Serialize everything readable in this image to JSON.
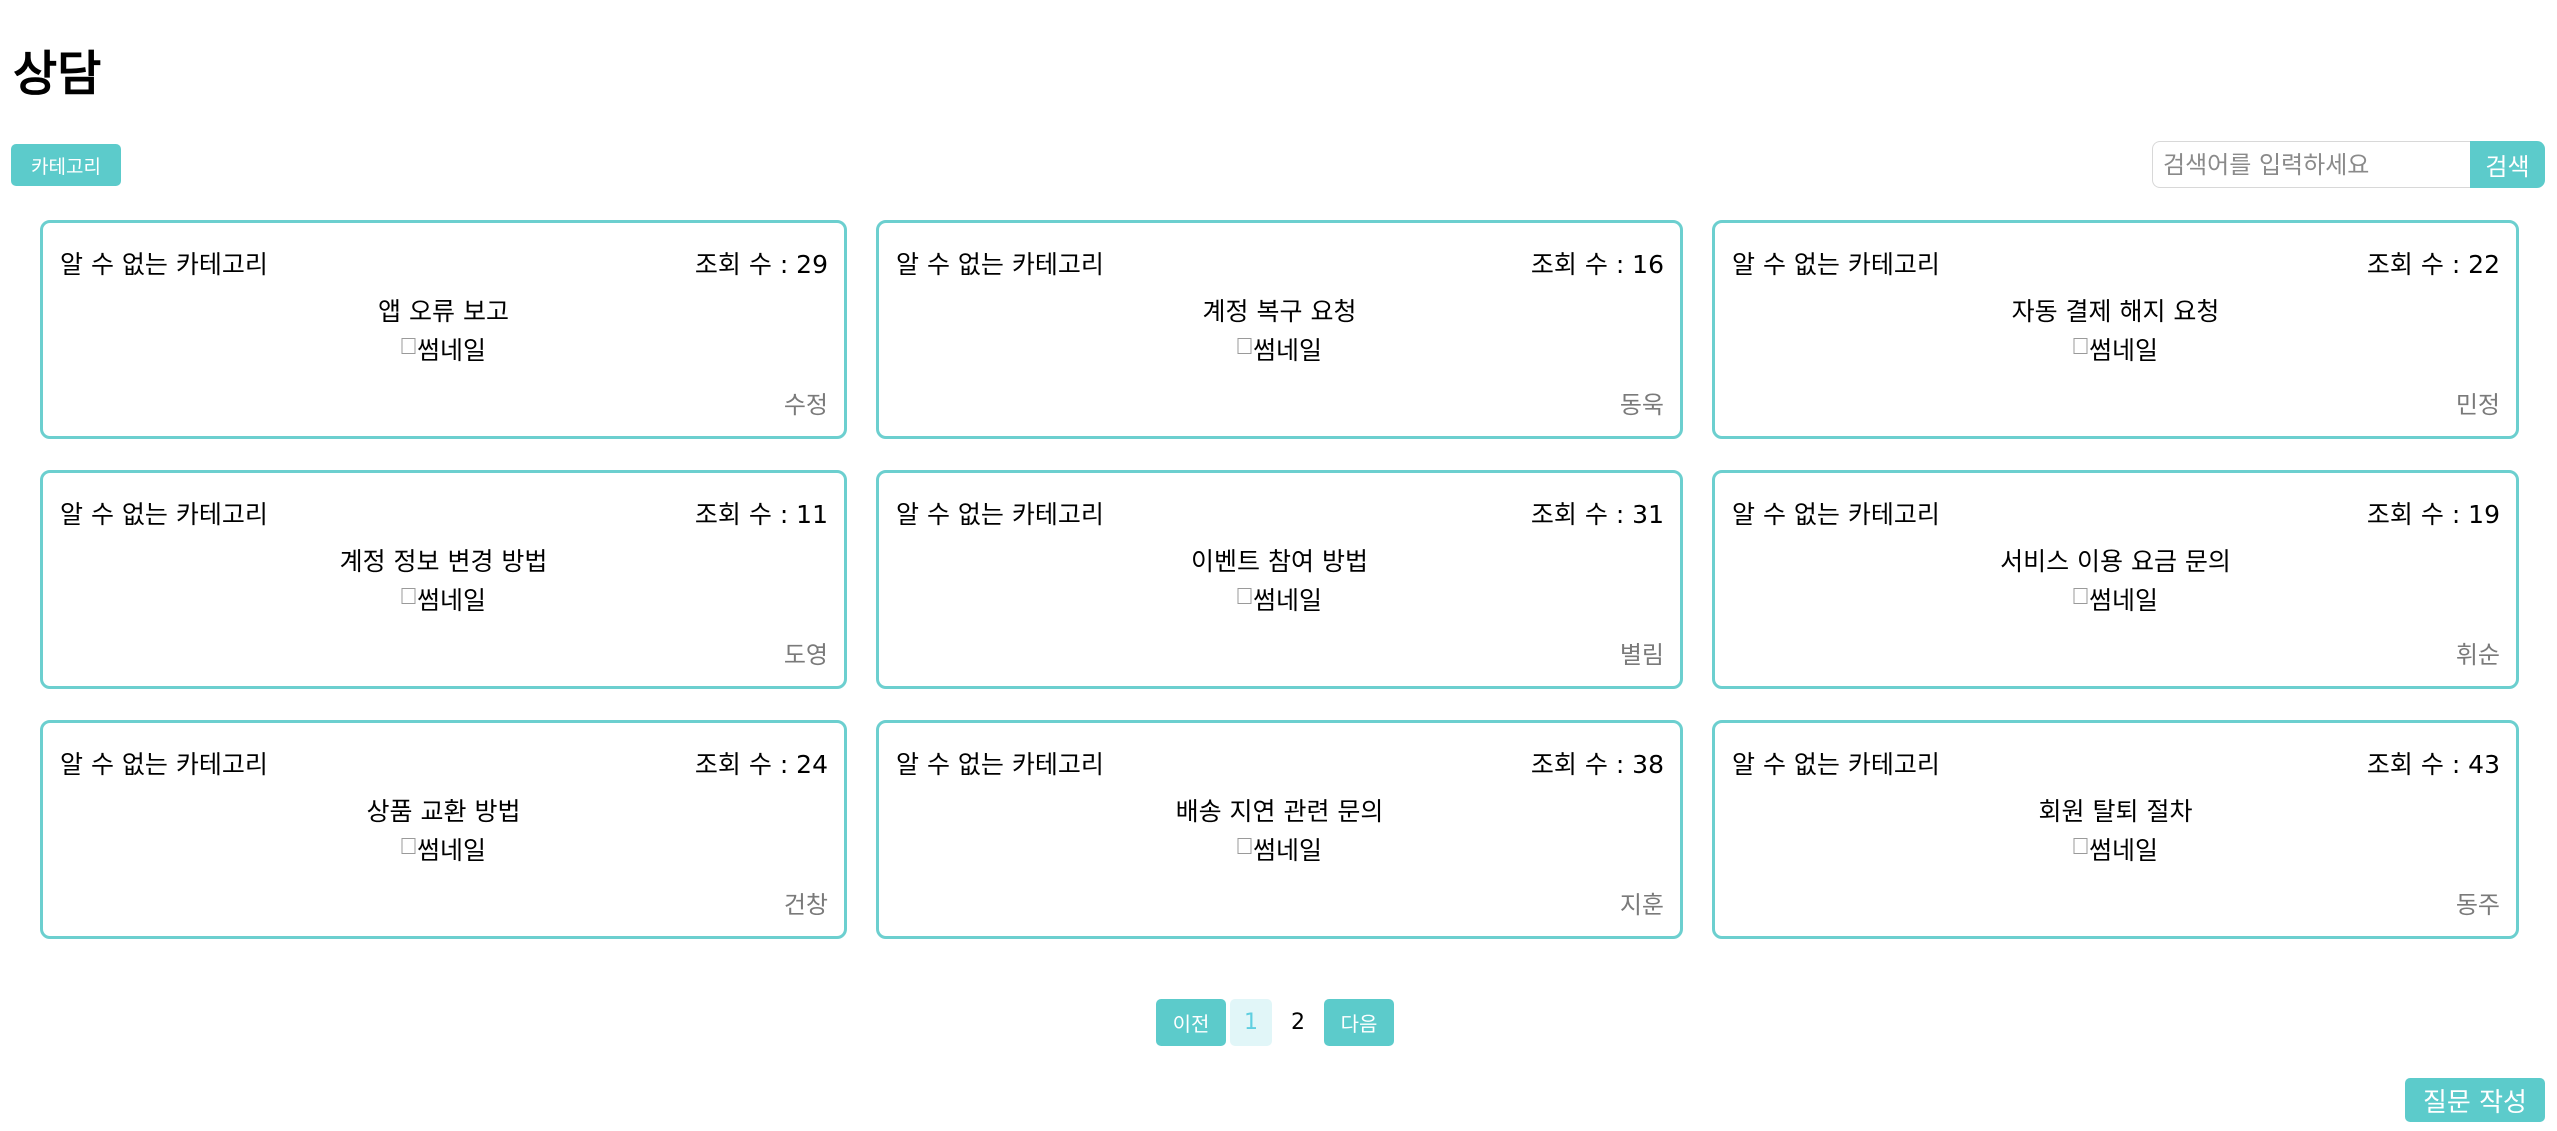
{
  "page": {
    "title": "상담"
  },
  "toolbar": {
    "category_label": "카테고리",
    "search_placeholder": "검색어를 입력하세요",
    "search_value": "",
    "search_button_label": "검색"
  },
  "cards": [
    {
      "category": "알 수 없는 카테고리",
      "views": "조회 수 : 29",
      "title": "앱 오류 보고",
      "thumbnail_alt": "썸네일",
      "author": "수정"
    },
    {
      "category": "알 수 없는 카테고리",
      "views": "조회 수 : 16",
      "title": "계정 복구 요청",
      "thumbnail_alt": "썸네일",
      "author": "동욱"
    },
    {
      "category": "알 수 없는 카테고리",
      "views": "조회 수 : 22",
      "title": "자동 결제 해지 요청",
      "thumbnail_alt": "썸네일",
      "author": "민정"
    },
    {
      "category": "알 수 없는 카테고리",
      "views": "조회 수 : 11",
      "title": "계정 정보 변경 방법",
      "thumbnail_alt": "썸네일",
      "author": "도영"
    },
    {
      "category": "알 수 없는 카테고리",
      "views": "조회 수 : 31",
      "title": "이벤트 참여 방법",
      "thumbnail_alt": "썸네일",
      "author": "별림"
    },
    {
      "category": "알 수 없는 카테고리",
      "views": "조회 수 : 19",
      "title": "서비스 이용 요금 문의",
      "thumbnail_alt": "썸네일",
      "author": "휘순"
    },
    {
      "category": "알 수 없는 카테고리",
      "views": "조회 수 : 24",
      "title": "상품 교환 방법",
      "thumbnail_alt": "썸네일",
      "author": "건창"
    },
    {
      "category": "알 수 없는 카테고리",
      "views": "조회 수 : 38",
      "title": "배송 지연 관련 문의",
      "thumbnail_alt": "썸네일",
      "author": "지훈"
    },
    {
      "category": "알 수 없는 카테고리",
      "views": "조회 수 : 43",
      "title": "회원 탈퇴 절차",
      "thumbnail_alt": "썸네일",
      "author": "동주"
    }
  ],
  "pagination": {
    "prev_label": "이전",
    "pages": [
      "1",
      "2"
    ],
    "current_page": "1",
    "next_label": "다음"
  },
  "footer": {
    "write_button_label": "질문 작성"
  },
  "colors": {
    "accent": "#5ccbcb",
    "card_border": "#6ccfcf",
    "active_page_bg": "#e1f6f8",
    "active_page_text": "#5fcfe0",
    "author_text": "#7a7a7a"
  }
}
